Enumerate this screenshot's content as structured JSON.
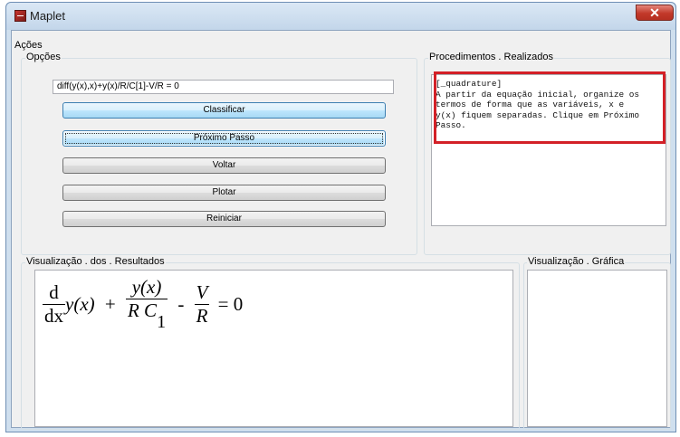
{
  "window": {
    "title": "Maplet",
    "close_glyph": "✕"
  },
  "menu": {
    "label": "Ações"
  },
  "options_group": {
    "title": "Opções",
    "equation_input": "diff(y(x),x)+y(x)/R/C[1]-V/R = 0",
    "buttons": [
      "Classificar",
      "Próximo Passo",
      "Voltar",
      "Plotar",
      "Reiniciar"
    ]
  },
  "procedures_group": {
    "title": "Procedimentos . Realizados",
    "text": "[_quadrature]\nA partir da equação inicial, organize os\ntermos de forma que as variáveis, x e\ny(x) fiquem separadas. Clique em Próximo\nPasso."
  },
  "results_group": {
    "title": "Visualização . dos . Resultados",
    "equation": {
      "d_num": "d",
      "d_den": "dx",
      "y_of_x": "y(x)",
      "plus": "+",
      "frac1_num": "y(x)",
      "frac1_den_main": "R C",
      "frac1_den_sub": "1",
      "minus": "-",
      "frac2_num": "V",
      "frac2_den": "R",
      "equals": "= 0"
    }
  },
  "graphics_group": {
    "title": "Visualização . Gráfica"
  },
  "colors": {
    "highlight": "#d32027",
    "focus_border": "#3c7fb1"
  }
}
